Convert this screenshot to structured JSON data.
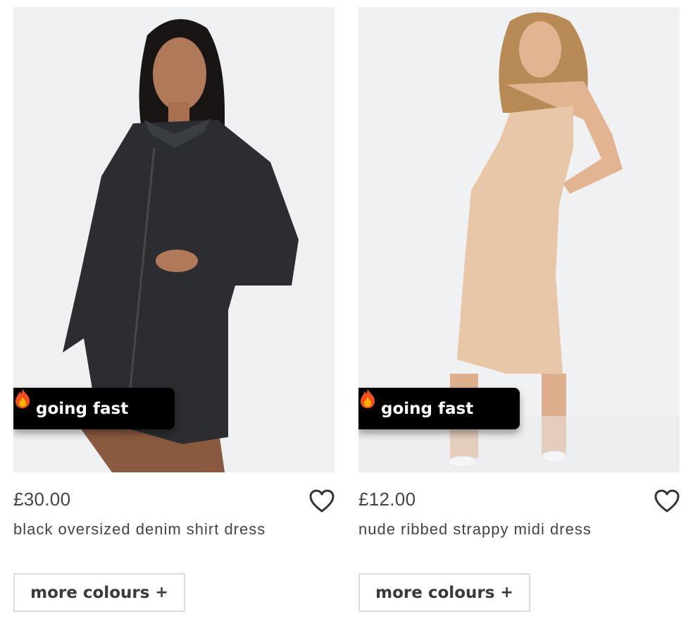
{
  "products": [
    {
      "badge": "going fast",
      "badge_icon": "fire-icon",
      "price": "£30.00",
      "title": "black oversized denim shirt dress",
      "more_colours": "more colours",
      "more_icon": "+",
      "wishlist_icon": "heart-icon",
      "garment_color": "#2b2d30"
    },
    {
      "badge": "going fast",
      "badge_icon": "fire-icon",
      "price": "£12.00",
      "title": "nude ribbed strappy midi dress",
      "more_colours": "more colours",
      "more_icon": "+",
      "wishlist_icon": "heart-icon",
      "garment_color": "#e8c7a9"
    }
  ]
}
